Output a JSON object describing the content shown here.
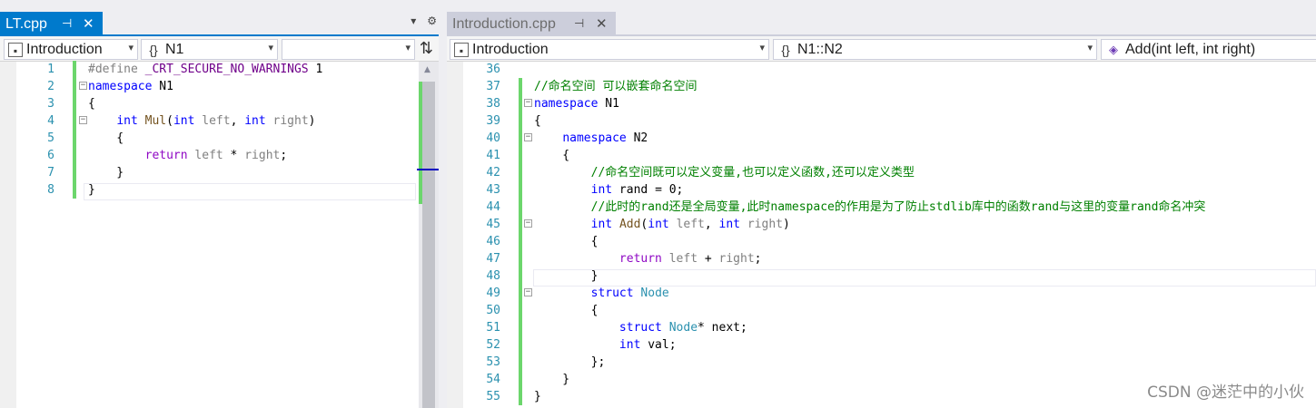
{
  "left": {
    "tab": {
      "title": "LT.cpp",
      "pin": "⊣",
      "close": "✕"
    },
    "strip_tools": {
      "dropdown": "▾",
      "settings": "⚙"
    },
    "nav": {
      "project": "Introduction",
      "scope": "N1",
      "member": "",
      "split": "⇅"
    },
    "lines": [
      {
        "n": "1",
        "tokens": [
          [
            "pp",
            "#define "
          ],
          [
            "mc",
            "_CRT_SECURE_NO_WARNINGS"
          ],
          [
            "tx",
            " 1"
          ]
        ]
      },
      {
        "n": "2",
        "tokens": [
          [
            "kw",
            "namespace"
          ],
          [
            "tx",
            " N1"
          ]
        ]
      },
      {
        "n": "3",
        "tokens": [
          [
            "tx",
            "{"
          ]
        ]
      },
      {
        "n": "4",
        "tokens": [
          [
            "tx",
            "    "
          ],
          [
            "kw",
            "int"
          ],
          [
            "tx",
            " "
          ],
          [
            "fn",
            "Mul"
          ],
          [
            "tx",
            "("
          ],
          [
            "kw",
            "int"
          ],
          [
            "tx",
            " "
          ],
          [
            "pm",
            "left"
          ],
          [
            "tx",
            ", "
          ],
          [
            "kw",
            "int"
          ],
          [
            "tx",
            " "
          ],
          [
            "pm",
            "right"
          ],
          [
            "tx",
            ")"
          ]
        ]
      },
      {
        "n": "5",
        "tokens": [
          [
            "tx",
            "    {"
          ]
        ]
      },
      {
        "n": "6",
        "tokens": [
          [
            "tx",
            "        "
          ],
          [
            "kp",
            "return"
          ],
          [
            "tx",
            " "
          ],
          [
            "pm",
            "left"
          ],
          [
            "tx",
            " * "
          ],
          [
            "pm",
            "right"
          ],
          [
            "tx",
            ";"
          ]
        ]
      },
      {
        "n": "7",
        "tokens": [
          [
            "tx",
            "    }"
          ]
        ]
      },
      {
        "n": "8",
        "tokens": [
          [
            "tx",
            "}"
          ]
        ]
      }
    ]
  },
  "right": {
    "tab": {
      "title": "Introduction.cpp",
      "pin": "⊣",
      "close": "✕"
    },
    "nav": {
      "project": "Introduction",
      "scope": "N1::N2",
      "member": "Add(int left, int right)"
    },
    "lines": [
      {
        "n": "36",
        "tokens": []
      },
      {
        "n": "37",
        "tokens": [
          [
            "cm",
            "//命名空间 可以嵌套命名空间"
          ]
        ]
      },
      {
        "n": "38",
        "tokens": [
          [
            "kw",
            "namespace"
          ],
          [
            "tx",
            " N1"
          ]
        ]
      },
      {
        "n": "39",
        "tokens": [
          [
            "tx",
            "{"
          ]
        ]
      },
      {
        "n": "40",
        "tokens": [
          [
            "tx",
            "    "
          ],
          [
            "kw",
            "namespace"
          ],
          [
            "tx",
            " N2"
          ]
        ]
      },
      {
        "n": "41",
        "tokens": [
          [
            "tx",
            "    {"
          ]
        ]
      },
      {
        "n": "42",
        "tokens": [
          [
            "tx",
            "        "
          ],
          [
            "cm",
            "//命名空间既可以定义变量,也可以定义函数,还可以定义类型"
          ]
        ]
      },
      {
        "n": "43",
        "tokens": [
          [
            "tx",
            "        "
          ],
          [
            "kw",
            "int"
          ],
          [
            "tx",
            " rand = 0;"
          ]
        ]
      },
      {
        "n": "44",
        "tokens": [
          [
            "tx",
            "        "
          ],
          [
            "cm",
            "//此时的rand还是全局变量,此时namespace的作用是为了防止stdlib库中的函数rand与这里的变量rand命名冲突"
          ]
        ]
      },
      {
        "n": "45",
        "tokens": [
          [
            "tx",
            "        "
          ],
          [
            "kw",
            "int"
          ],
          [
            "tx",
            " "
          ],
          [
            "fn",
            "Add"
          ],
          [
            "tx",
            "("
          ],
          [
            "kw",
            "int"
          ],
          [
            "tx",
            " "
          ],
          [
            "pm",
            "left"
          ],
          [
            "tx",
            ", "
          ],
          [
            "kw",
            "int"
          ],
          [
            "tx",
            " "
          ],
          [
            "pm",
            "right"
          ],
          [
            "tx",
            ")"
          ]
        ]
      },
      {
        "n": "46",
        "tokens": [
          [
            "tx",
            "        {"
          ]
        ]
      },
      {
        "n": "47",
        "tokens": [
          [
            "tx",
            "            "
          ],
          [
            "kp",
            "return"
          ],
          [
            "tx",
            " "
          ],
          [
            "pm",
            "left"
          ],
          [
            "tx",
            " + "
          ],
          [
            "pm",
            "right"
          ],
          [
            "tx",
            ";"
          ]
        ]
      },
      {
        "n": "48",
        "tokens": [
          [
            "tx",
            "        }"
          ]
        ]
      },
      {
        "n": "49",
        "tokens": [
          [
            "tx",
            "        "
          ],
          [
            "kw",
            "struct"
          ],
          [
            "tx",
            " "
          ],
          [
            "ty",
            "Node"
          ]
        ]
      },
      {
        "n": "50",
        "tokens": [
          [
            "tx",
            "        {"
          ]
        ]
      },
      {
        "n": "51",
        "tokens": [
          [
            "tx",
            "            "
          ],
          [
            "kw",
            "struct"
          ],
          [
            "tx",
            " "
          ],
          [
            "ty",
            "Node"
          ],
          [
            "tx",
            "* next;"
          ]
        ]
      },
      {
        "n": "52",
        "tokens": [
          [
            "tx",
            "            "
          ],
          [
            "kw",
            "int"
          ],
          [
            "tx",
            " val;"
          ]
        ]
      },
      {
        "n": "53",
        "tokens": [
          [
            "tx",
            "        };"
          ]
        ]
      },
      {
        "n": "54",
        "tokens": [
          [
            "tx",
            "    }"
          ]
        ]
      },
      {
        "n": "55",
        "tokens": [
          [
            "tx",
            "}"
          ]
        ]
      }
    ]
  },
  "watermark": "CSDN @迷茫中的小伙",
  "colors": {
    "accent": "#007acc",
    "line_number": "#2b91af",
    "keyword": "#0000ff",
    "comment": "#008000",
    "change_bar": "#6cd66c"
  }
}
